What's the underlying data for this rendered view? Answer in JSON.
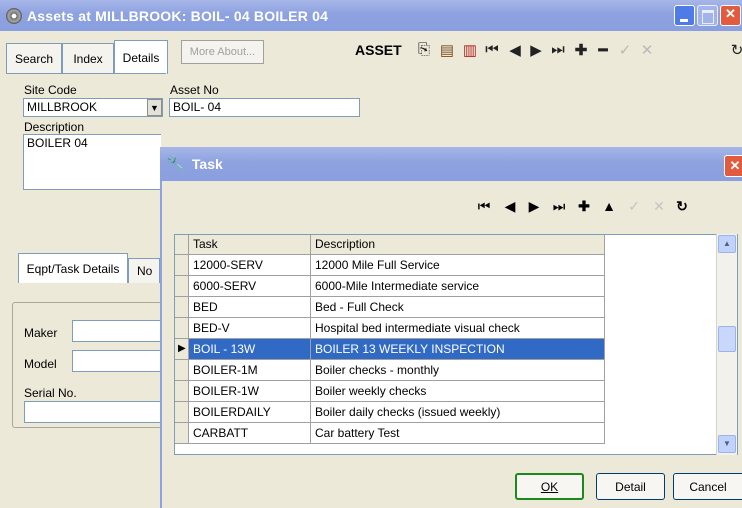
{
  "window": {
    "title": "Assets at MILLBROOK: BOIL- 04 BOILER 04"
  },
  "tabs": [
    {
      "label": "Search"
    },
    {
      "label": "Index"
    },
    {
      "label": "Details"
    }
  ],
  "toolbar": {
    "more_about_label": "More About...",
    "asset_label": "ASSET",
    "icons": [
      "copy-icon",
      "paste-icon",
      "paste-special-icon",
      "first-record-icon",
      "prev-record-icon",
      "next-record-icon",
      "last-record-icon",
      "add-record-icon",
      "delete-record-icon",
      "save-icon",
      "cancel-icon",
      "refresh-icon"
    ]
  },
  "form": {
    "site_code_label": "Site Code",
    "site_code_value": "MILLBROOK",
    "asset_no_label": "Asset No",
    "asset_no_value": "BOIL- 04",
    "description_label": "Description",
    "description_value": "BOILER 04",
    "subtab_eqpt": "Eqpt/Task Details",
    "subtab_no": "No",
    "maker_label": "Maker",
    "model_label": "Model",
    "serial_label": "Serial No."
  },
  "dialog": {
    "title": "Task",
    "columns": [
      "Task",
      "Description"
    ],
    "rows": [
      {
        "task": "12000-SERV",
        "description": "12000 Mile Full Service"
      },
      {
        "task": "6000-SERV",
        "description": "6000-Mile Intermediate service"
      },
      {
        "task": "BED",
        "description": "Bed -  Full Check"
      },
      {
        "task": "BED-V",
        "description": "Hospital bed intermediate visual check"
      },
      {
        "task": "BOIL - 13W",
        "description": "BOILER 13 WEEKLY INSPECTION"
      },
      {
        "task": "BOILER-1M",
        "description": "Boiler checks - monthly"
      },
      {
        "task": "BOILER-1W",
        "description": "Boiler weekly checks"
      },
      {
        "task": "BOILERDAILY",
        "description": "Boiler daily checks (issued weekly)"
      },
      {
        "task": "CARBATT",
        "description": "Car battery Test"
      }
    ],
    "selected_row": 4,
    "ok_label": "OK",
    "detail_label": "Detail",
    "cancel_label": "Cancel"
  },
  "colors": {
    "selection": "#316ac5",
    "title_bar": "#8ea2e0",
    "close_button": "#e35b3f",
    "ok_border": "#1a8a1a"
  }
}
